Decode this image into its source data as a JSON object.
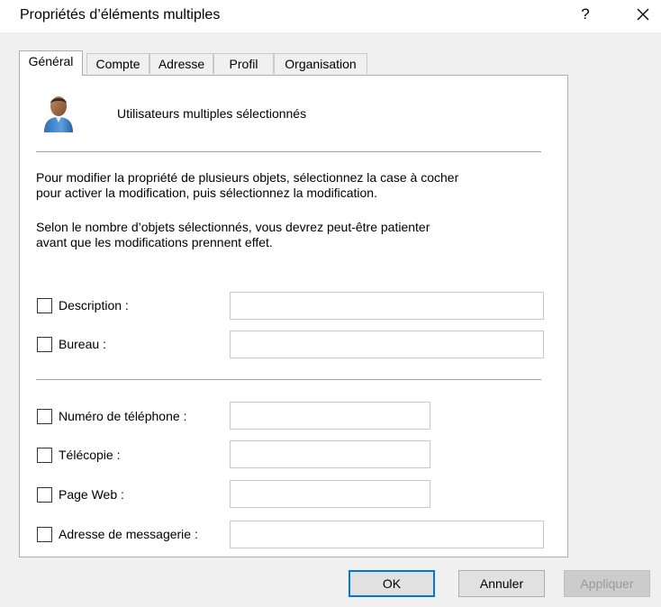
{
  "window": {
    "title": "Propriétés d’éléments multiples",
    "help_label": "?"
  },
  "tabs": [
    {
      "label": "Général",
      "active": true
    },
    {
      "label": "Compte",
      "active": false
    },
    {
      "label": "Adresse",
      "active": false
    },
    {
      "label": "Profil",
      "active": false
    },
    {
      "label": "Organisation",
      "active": false
    }
  ],
  "header": {
    "icon": "user-icon",
    "text": "Utilisateurs multiples sélectionnés"
  },
  "info": {
    "paragraph1_line1": "Pour modifier la propriété de plusieurs objets, sélectionnez la case à cocher",
    "paragraph1_line2": "pour activer la modification, puis sélectionnez la modification.",
    "paragraph2_line1": "Selon le nombre d’objets sélectionnés, vous devrez peut-être patienter",
    "paragraph2_line2": "avant que les modifications prennent effet."
  },
  "fields": {
    "description": {
      "label": "Description :",
      "checked": false,
      "value": ""
    },
    "bureau": {
      "label": "Bureau :",
      "checked": false,
      "value": ""
    },
    "telephone": {
      "label": "Numéro de téléphone :",
      "checked": false,
      "value": ""
    },
    "telecopie": {
      "label": "Télécopie :",
      "checked": false,
      "value": ""
    },
    "page_web": {
      "label": "Page Web :",
      "checked": false,
      "value": ""
    },
    "email": {
      "label": "Adresse de messagerie :",
      "checked": false,
      "value": ""
    }
  },
  "buttons": {
    "ok": "OK",
    "cancel": "Annuler",
    "apply": "Appliquer"
  },
  "colors": {
    "accent": "#0078d7",
    "dialog_background": "#f0f0f0"
  }
}
